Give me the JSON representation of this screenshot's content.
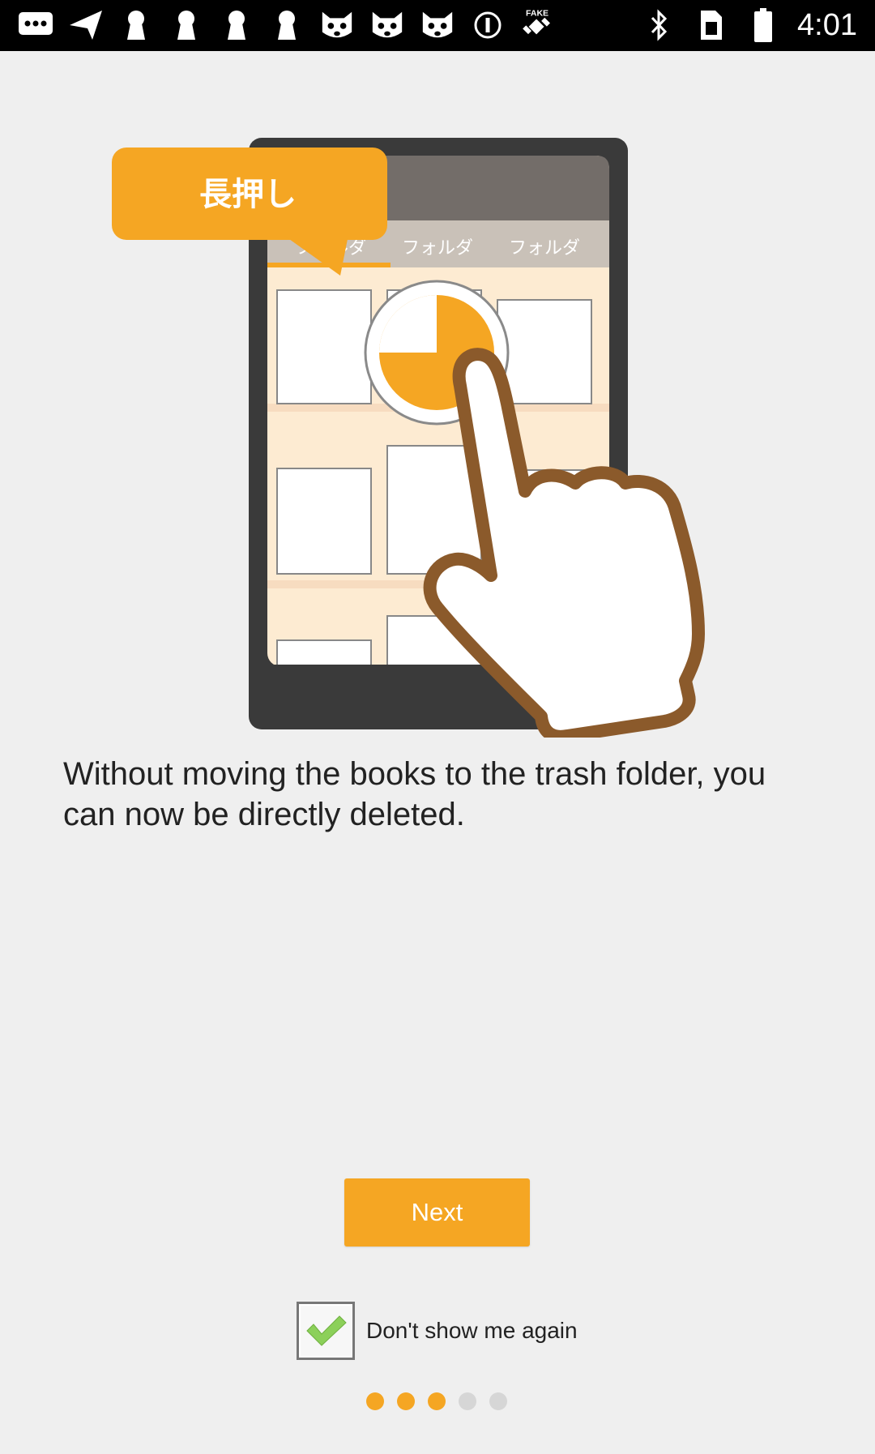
{
  "status_bar": {
    "time": "4:01",
    "left_icons": [
      "message-icon",
      "navigation-icon",
      "keyhole-icon",
      "keyhole-icon",
      "keyhole-icon",
      "keyhole-icon",
      "cat-icon",
      "cat-icon",
      "cat-icon",
      "info-circle-icon",
      "fake-gps-icon"
    ],
    "right_icons": [
      "bluetooth-icon",
      "sim-card-icon",
      "battery-icon"
    ],
    "fake_label": "FAKE"
  },
  "illustration": {
    "bubble_text": "長押し",
    "tabs": [
      "フォルダ",
      "フォルダ",
      "フォルダ"
    ],
    "colors": {
      "accent": "#f5a623",
      "phone_body": "#3a3a3a",
      "screen_header": "#736d69",
      "tab_bar": "#c9c1b8",
      "shelf_bg": "#fdebd2",
      "hand_outline": "#8b5a2b"
    }
  },
  "main": {
    "description": "Without moving the books to the trash folder, you can now be directly deleted."
  },
  "buttons": {
    "next_label": "Next"
  },
  "dont_show": {
    "label": "Don't show me again",
    "checked": true
  },
  "pager": {
    "total": 5,
    "active_count": 3,
    "active_color": "#f5a623",
    "inactive_color": "#d6d6d6"
  }
}
